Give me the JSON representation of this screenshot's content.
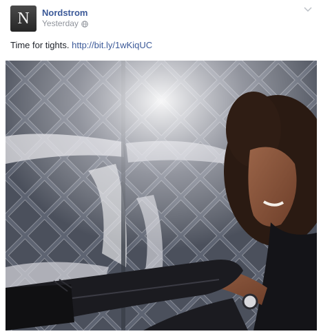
{
  "post": {
    "page_name": "Nordstrom",
    "avatar_letter": "N",
    "timestamp": "Yesterday",
    "privacy_icon": "globe-icon",
    "menu_icon": "chevron-down-icon",
    "caption_text": "Time for tights. ",
    "caption_link": "http://bit.ly/1wKiqUC"
  },
  "colors": {
    "link": "#3b5998",
    "meta": "#90949c",
    "text": "#1d2129"
  }
}
